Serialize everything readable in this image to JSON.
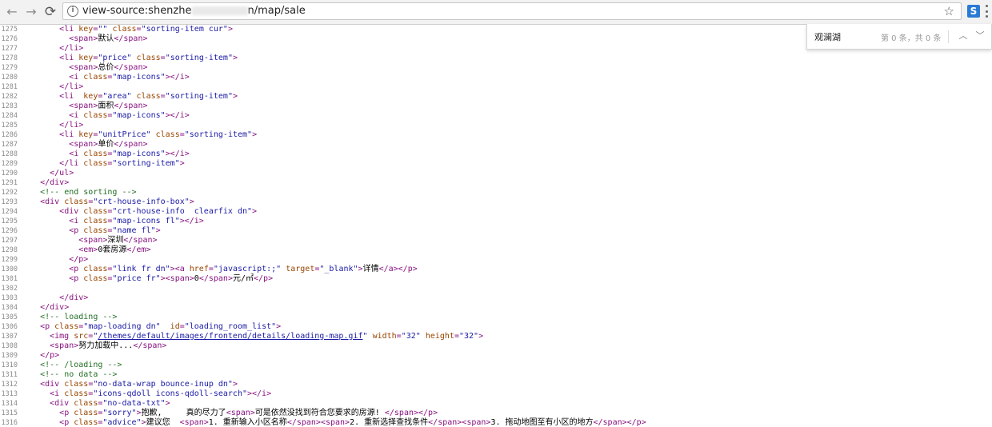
{
  "browser": {
    "url_prefix": "view-source:shenzhe",
    "url_suffix": "n/map/sale",
    "back_glyph": "←",
    "forward_glyph": "→",
    "reload_glyph": "⟳",
    "info_glyph": "i",
    "star_glyph": "☆",
    "ext_label": "S"
  },
  "find_bar": {
    "query": "观澜湖",
    "count_text": "第 0 条，共 0 条",
    "up_glyph": "︿",
    "down_glyph": "﹀",
    "close_glyph": "✕"
  },
  "source_lines": [
    {
      "n": "1275",
      "html": "        <span class=\"tag\">&lt;li </span><span class=\"attr\">key</span><span class=\"tag\">=</span><span class=\"val\">\"\"</span> <span class=\"attr\">class</span><span class=\"tag\">=</span><span class=\"val\">\"sorting-item cur\"</span><span class=\"tag\">&gt;</span>"
    },
    {
      "n": "1276",
      "html": "          <span class=\"tag\">&lt;span&gt;</span><span class=\"txt\">默认</span><span class=\"tag\">&lt;/span&gt;</span>"
    },
    {
      "n": "1277",
      "html": "        <span class=\"tag\">&lt;/li&gt;</span>"
    },
    {
      "n": "1278",
      "html": "        <span class=\"tag\">&lt;li </span><span class=\"attr\">key</span><span class=\"tag\">=</span><span class=\"val\">\"price\"</span> <span class=\"attr\">class</span><span class=\"tag\">=</span><span class=\"val\">\"sorting-item\"</span><span class=\"tag\">&gt;</span>"
    },
    {
      "n": "1279",
      "html": "          <span class=\"tag\">&lt;span&gt;</span><span class=\"txt\">总价</span><span class=\"tag\">&lt;/span&gt;</span>"
    },
    {
      "n": "1280",
      "html": "          <span class=\"tag\">&lt;i </span><span class=\"attr\">class</span><span class=\"tag\">=</span><span class=\"val\">\"map-icons\"</span><span class=\"tag\">&gt;&lt;/i&gt;</span>"
    },
    {
      "n": "1281",
      "html": "        <span class=\"tag\">&lt;/li&gt;</span>"
    },
    {
      "n": "1282",
      "html": "        <span class=\"tag\">&lt;li  </span><span class=\"attr\">key</span><span class=\"tag\">=</span><span class=\"val\">\"area\"</span> <span class=\"attr\">class</span><span class=\"tag\">=</span><span class=\"val\">\"sorting-item\"</span><span class=\"tag\">&gt;</span>"
    },
    {
      "n": "1283",
      "html": "          <span class=\"tag\">&lt;span&gt;</span><span class=\"txt\">面积</span><span class=\"tag\">&lt;/span&gt;</span>"
    },
    {
      "n": "1284",
      "html": "          <span class=\"tag\">&lt;i </span><span class=\"attr\">class</span><span class=\"tag\">=</span><span class=\"val\">\"map-icons\"</span><span class=\"tag\">&gt;&lt;/i&gt;</span>"
    },
    {
      "n": "1285",
      "html": "        <span class=\"tag\">&lt;/li&gt;</span>"
    },
    {
      "n": "1286",
      "html": "        <span class=\"tag\">&lt;li </span><span class=\"attr\">key</span><span class=\"tag\">=</span><span class=\"val\">\"unitPrice\"</span> <span class=\"attr\">class</span><span class=\"tag\">=</span><span class=\"val\">\"sorting-item\"</span><span class=\"tag\">&gt;</span>"
    },
    {
      "n": "1287",
      "html": "          <span class=\"tag\">&lt;span&gt;</span><span class=\"txt\">单价</span><span class=\"tag\">&lt;/span&gt;</span>"
    },
    {
      "n": "1288",
      "html": "          <span class=\"tag\">&lt;i </span><span class=\"attr\">class</span><span class=\"tag\">=</span><span class=\"val\">\"map-icons\"</span><span class=\"tag\">&gt;&lt;/i&gt;</span>"
    },
    {
      "n": "1289",
      "html": "        <span class=\"tag\">&lt;/li </span><span class=\"attr\">class</span><span class=\"tag\">=</span><span class=\"val\">\"sorting-item\"</span><span class=\"tag\">&gt;</span>"
    },
    {
      "n": "1290",
      "html": "      <span class=\"tag\">&lt;/ul&gt;</span>"
    },
    {
      "n": "1291",
      "html": "    <span class=\"tag\">&lt;/div&gt;</span>"
    },
    {
      "n": "1292",
      "html": "    <span class=\"cmt\">&lt;!-- end sorting --&gt;</span>"
    },
    {
      "n": "1293",
      "html": "    <span class=\"tag\">&lt;div </span><span class=\"attr\">class</span><span class=\"tag\">=</span><span class=\"val\">\"crt-house-info-box\"</span><span class=\"tag\">&gt;</span>"
    },
    {
      "n": "1294",
      "html": "        <span class=\"tag\">&lt;div </span><span class=\"attr\">class</span><span class=\"tag\">=</span><span class=\"val\">\"crt-house-info  clearfix dn\"</span><span class=\"tag\">&gt;</span>"
    },
    {
      "n": "1295",
      "html": "          <span class=\"tag\">&lt;i </span><span class=\"attr\">class</span><span class=\"tag\">=</span><span class=\"val\">\"map-icons fl\"</span><span class=\"tag\">&gt;&lt;/i&gt;</span>"
    },
    {
      "n": "1296",
      "html": "          <span class=\"tag\">&lt;p </span><span class=\"attr\">class</span><span class=\"tag\">=</span><span class=\"val\">\"name fl\"</span><span class=\"tag\">&gt;</span>"
    },
    {
      "n": "1297",
      "html": "            <span class=\"tag\">&lt;span&gt;</span><span class=\"txt\">深圳</span><span class=\"tag\">&lt;/span&gt;</span>"
    },
    {
      "n": "1298",
      "html": "            <span class=\"tag\">&lt;em&gt;</span><span class=\"txt\">0套房源</span><span class=\"tag\">&lt;/em&gt;</span>"
    },
    {
      "n": "1299",
      "html": "          <span class=\"tag\">&lt;/p&gt;</span>"
    },
    {
      "n": "1300",
      "html": "          <span class=\"tag\">&lt;p </span><span class=\"attr\">class</span><span class=\"tag\">=</span><span class=\"val\">\"link fr dn\"</span><span class=\"tag\">&gt;&lt;a </span><span class=\"attr\">href</span><span class=\"tag\">=</span><span class=\"val\">\"javascript:;\"</span> <span class=\"attr\">target</span><span class=\"tag\">=</span><span class=\"val\">\"_blank\"</span><span class=\"tag\">&gt;</span><span class=\"txt\">详情</span><span class=\"tag\">&lt;/a&gt;&lt;/p&gt;</span>"
    },
    {
      "n": "1301",
      "html": "          <span class=\"tag\">&lt;p </span><span class=\"attr\">class</span><span class=\"tag\">=</span><span class=\"val\">\"price fr\"</span><span class=\"tag\">&gt;&lt;span&gt;</span><span class=\"txt\">0</span><span class=\"tag\">&lt;/span&gt;</span><span class=\"txt\">元/㎡</span><span class=\"tag\">&lt;/p&gt;</span>"
    },
    {
      "n": "1302",
      "html": ""
    },
    {
      "n": "1303",
      "html": "        <span class=\"tag\">&lt;/div&gt;</span>"
    },
    {
      "n": "1304",
      "html": "    <span class=\"tag\">&lt;/div&gt;</span>"
    },
    {
      "n": "1305",
      "html": "    <span class=\"cmt\">&lt;!-- loading --&gt;</span>"
    },
    {
      "n": "1306",
      "html": "    <span class=\"tag\">&lt;p </span><span class=\"attr\">class</span><span class=\"tag\">=</span><span class=\"val\">\"map-loading dn\"</span>  <span class=\"attr\">id</span><span class=\"tag\">=</span><span class=\"val\">\"loading_room_list\"</span><span class=\"tag\">&gt;</span>"
    },
    {
      "n": "1307",
      "html": "      <span class=\"tag\">&lt;img </span><span class=\"attr\">src</span><span class=\"tag\">=</span><span class=\"val\">\"</span><span class=\"link\">/themes/default/images/frontend/details/loading-map.gif</span><span class=\"val\">\"</span> <span class=\"attr\">width</span><span class=\"tag\">=</span><span class=\"val\">\"32\"</span> <span class=\"attr\">height</span><span class=\"tag\">=</span><span class=\"val\">\"32\"</span><span class=\"tag\">&gt;</span>"
    },
    {
      "n": "1308",
      "html": "      <span class=\"tag\">&lt;span&gt;</span><span class=\"txt\">努力加载中...</span><span class=\"tag\">&lt;/span&gt;</span>"
    },
    {
      "n": "1309",
      "html": "    <span class=\"tag\">&lt;/p&gt;</span>"
    },
    {
      "n": "1310",
      "html": "    <span class=\"cmt\">&lt;!-- /loading --&gt;</span>"
    },
    {
      "n": "1311",
      "html": "    <span class=\"cmt\">&lt;!-- no data --&gt;</span>"
    },
    {
      "n": "1312",
      "html": "    <span class=\"tag\">&lt;div </span><span class=\"attr\">class</span><span class=\"tag\">=</span><span class=\"val\">\"no-data-wrap bounce-inup dn\"</span><span class=\"tag\">&gt;</span>"
    },
    {
      "n": "1313",
      "html": "      <span class=\"tag\">&lt;i </span><span class=\"attr\">class</span><span class=\"tag\">=</span><span class=\"val\">\"icons-qdoll icons-qdoll-search\"</span><span class=\"tag\">&gt;&lt;/i&gt;</span>"
    },
    {
      "n": "1314",
      "html": "      <span class=\"tag\">&lt;div </span><span class=\"attr\">class</span><span class=\"tag\">=</span><span class=\"val\">\"no-data-txt\"</span><span class=\"tag\">&gt;</span>"
    },
    {
      "n": "1315",
      "html": "        <span class=\"tag\">&lt;p </span><span class=\"attr\">class</span><span class=\"tag\">=</span><span class=\"val\">\"sorry\"</span><span class=\"tag\">&gt;</span><span class=\"txt\">抱歉,     真的尽力了</span><span class=\"tag\">&lt;span&gt;</span><span class=\"txt\">可是依然没找到符合您要求的房源! </span><span class=\"tag\">&lt;/span&gt;&lt;/p&gt;</span>"
    },
    {
      "n": "1316",
      "html": "        <span class=\"tag\">&lt;p </span><span class=\"attr\">class</span><span class=\"tag\">=</span><span class=\"val\">\"advice\"</span><span class=\"tag\">&gt;</span><span class=\"txt\">建议您</span><span class=\"tag\">  &lt;span&gt;</span><span class=\"txt\">1. 重新输入小区名称</span><span class=\"tag\">&lt;/span&gt;&lt;span&gt;</span><span class=\"txt\">2. 重新选择查找条件</span><span class=\"tag\">&lt;/span&gt;&lt;span&gt;</span><span class=\"txt\">3. 拖动地图至有小区的地方</span><span class=\"tag\">&lt;/span&gt;&lt;/p&gt;</span>"
    }
  ]
}
